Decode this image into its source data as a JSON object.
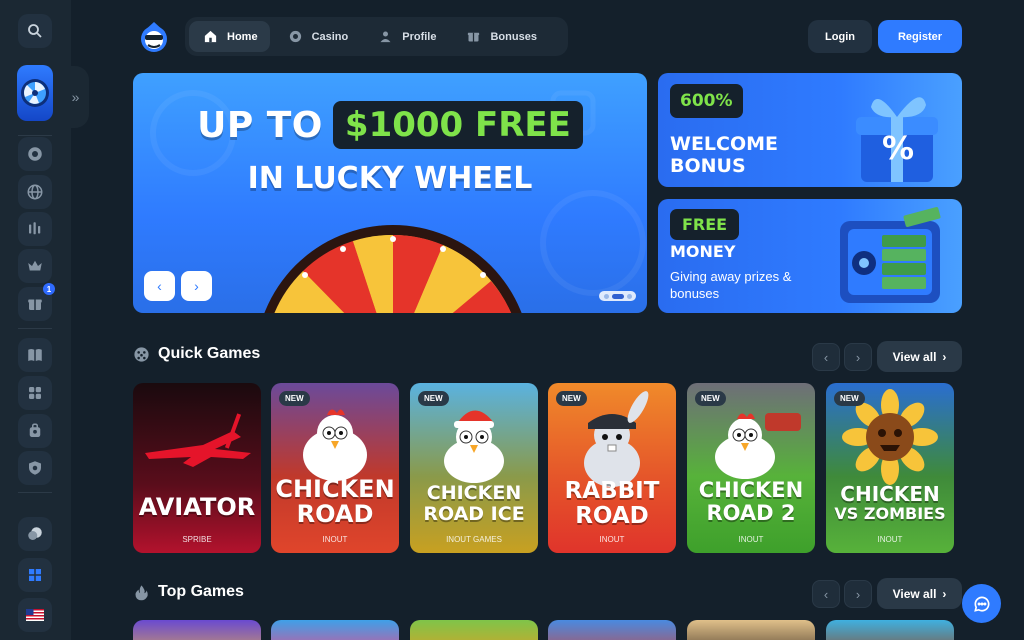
{
  "header": {
    "nav": [
      {
        "label": "Home",
        "icon": "home-icon",
        "active": true
      },
      {
        "label": "Casino",
        "icon": "chip-icon",
        "active": false
      },
      {
        "label": "Profile",
        "icon": "user-icon",
        "active": false
      },
      {
        "label": "Bonuses",
        "icon": "gift-icon",
        "active": false
      }
    ],
    "login_label": "Login",
    "register_label": "Register"
  },
  "sidebar": {
    "items": [
      "search-icon",
      "lucky-wheel",
      "expand-icon",
      "chip-icon",
      "globe-icon",
      "chart-icon",
      "crown-icon",
      "gift-icon",
      "book-icon",
      "puzzle-icon",
      "bag-icon",
      "shield-icon",
      "chat-bubbles-icon",
      "windows-icon",
      "flag-us-icon"
    ],
    "gift_badge": "1"
  },
  "hero": {
    "line1_prefix": "UP TO",
    "line1_amount": "$1000 FREE",
    "line2": "IN LUCKY WHEEL"
  },
  "promos": [
    {
      "tag": "600%",
      "title_line1": "WELCOME",
      "title_line2": "BONUS"
    },
    {
      "tag": "FREE",
      "title": "MONEY",
      "subtitle": "Giving away prizes & bonuses"
    }
  ],
  "quick_games": {
    "title": "Quick Games",
    "view_all": "View all",
    "games": [
      {
        "title_line1": "AVIATOR",
        "title_line2": "",
        "provider": "SPRIBE",
        "new": false
      },
      {
        "title_line1": "CHICKEN",
        "title_line2": "ROAD",
        "provider": "INOUT",
        "new": true,
        "new_label": "NEW"
      },
      {
        "title_line1": "CHICKEN",
        "title_line2": "ROAD ICE",
        "provider": "INOUT GAMES",
        "new": true,
        "new_label": "NEW"
      },
      {
        "title_line1": "RABBIT",
        "title_line2": "ROAD",
        "provider": "INOUT",
        "new": true,
        "new_label": "NEW"
      },
      {
        "title_line1": "CHICKEN",
        "title_line2": "ROAD 2",
        "provider": "INOUT",
        "new": true,
        "new_label": "NEW"
      },
      {
        "title_line1": "CHICKEN",
        "title_line2": "VS ZOMBIES",
        "provider": "INOUT",
        "new": true,
        "new_label": "NEW"
      }
    ]
  },
  "top_games": {
    "title": "Top Games",
    "view_all": "View all"
  }
}
